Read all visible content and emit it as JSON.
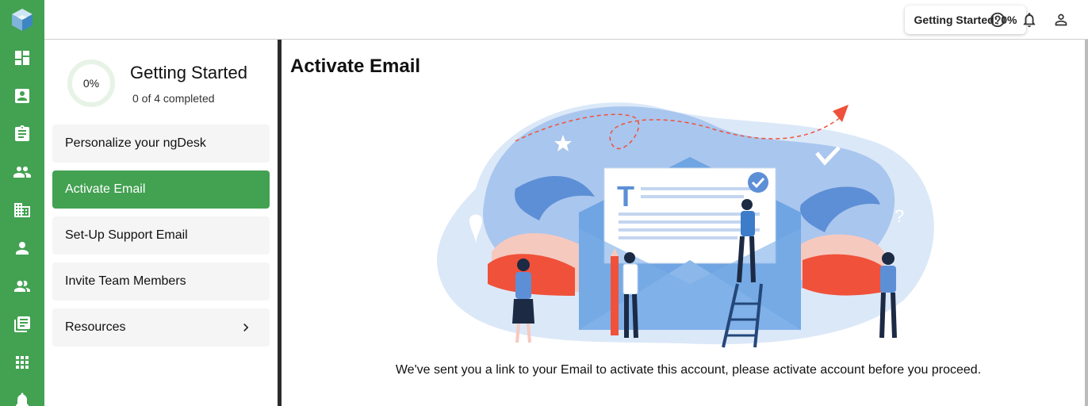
{
  "app": {
    "name": "ngDesk"
  },
  "rail": {
    "logo_icon": "cube-logo-icon",
    "items": [
      {
        "icon": "dashboard-icon"
      },
      {
        "icon": "contact-card-icon"
      },
      {
        "icon": "clipboard-icon"
      },
      {
        "icon": "people-icon"
      },
      {
        "icon": "building-icon"
      },
      {
        "icon": "person-icon"
      },
      {
        "icon": "group-icon"
      },
      {
        "icon": "articles-icon"
      },
      {
        "icon": "apps-grid-icon"
      },
      {
        "icon": "bell-icon"
      }
    ]
  },
  "topbar": {
    "getting_started_label": "Getting Started: 0%",
    "help_icon": "help-icon",
    "notifications_icon": "bell-icon",
    "account_icon": "person-icon"
  },
  "panel": {
    "progress_percent": 0,
    "progress_text": "0%",
    "title": "Getting Started",
    "subtitle": "0 of 4 completed",
    "steps": [
      {
        "label": "Personalize your ngDesk",
        "active": false
      },
      {
        "label": "Activate Email",
        "active": true
      },
      {
        "label": "Set-Up Support Email",
        "active": false
      },
      {
        "label": "Invite Team Members",
        "active": false
      },
      {
        "label": "Resources",
        "active": false,
        "chevron": "chevron-right-icon"
      }
    ]
  },
  "main": {
    "title": "Activate Email",
    "message": "We've sent you a link to your Email to activate this account, please activate account before you proceed."
  },
  "colors": {
    "brand_green": "#43a152",
    "illustration_blue": "#5d8fd6",
    "illustration_red": "#f0513a"
  }
}
